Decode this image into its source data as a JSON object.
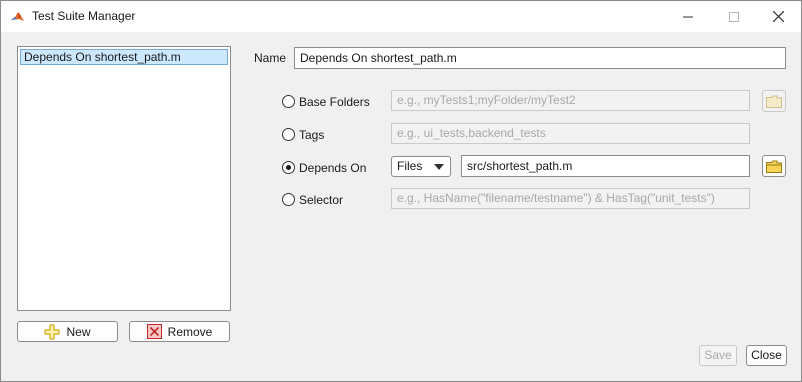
{
  "window": {
    "title": "Test Suite Manager"
  },
  "suite_list": {
    "items": [
      {
        "label": "Depends On shortest_path.m",
        "selected": true
      }
    ]
  },
  "list_buttons": {
    "new_label": "New",
    "remove_label": "Remove"
  },
  "form": {
    "name_label": "Name",
    "name_value": "Depends On shortest_path.m",
    "options": {
      "base_folders": {
        "label": "Base Folders",
        "placeholder": "e.g., myTests1;myFolder/myTest2",
        "selected": false
      },
      "tags": {
        "label": "Tags",
        "placeholder": "e.g., ui_tests,backend_tests",
        "selected": false
      },
      "depends_on": {
        "label": "Depends On",
        "type_value": "Files",
        "value": "src/shortest_path.m",
        "selected": true
      },
      "selector": {
        "label": "Selector",
        "placeholder": "e.g., HasName(\"filename/testname\") & HasTag(\"unit_tests\")",
        "selected": false
      }
    }
  },
  "footer": {
    "save_label": "Save",
    "close_label": "Close"
  },
  "icons": {
    "app": "matlab-icon",
    "folder": "folder-icon",
    "new": "plus-icon",
    "remove": "remove-icon"
  },
  "colors": {
    "selection": "#cce8ff",
    "selection_border": "#7aa9d6",
    "disabled_text": "#a8a8a8"
  }
}
